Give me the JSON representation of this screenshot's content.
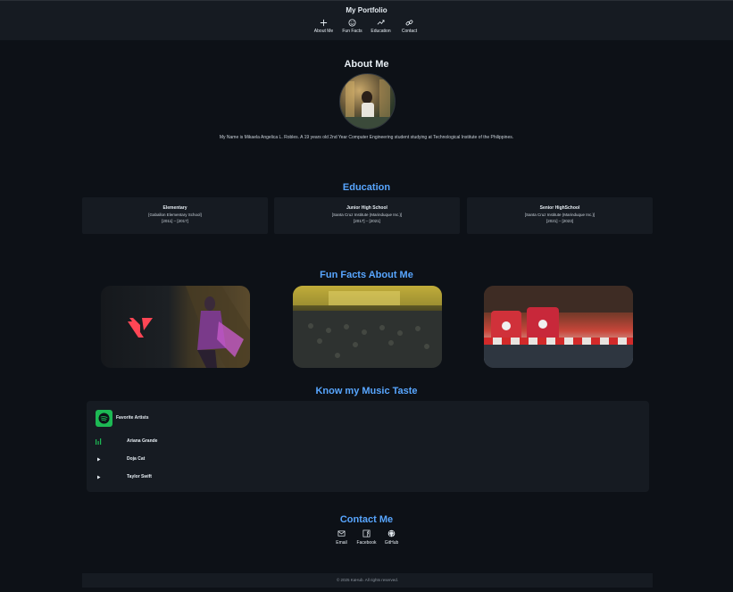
{
  "header": {
    "title": "My Portfolio",
    "nav": [
      {
        "label": "About Me",
        "icon": "plus-icon"
      },
      {
        "label": "Fun Facts",
        "icon": "smiley-icon"
      },
      {
        "label": "Education",
        "icon": "growth-icon"
      },
      {
        "label": "Contact",
        "icon": "chain-link-icon"
      }
    ]
  },
  "about": {
    "title": "About Me",
    "text": "My Name is Mikaela Angelica L. Robles. A 19 years old 2nd Year Computer Engineering student studying at Technological Institute of the Philippines."
  },
  "education": {
    "title": "Education",
    "items": [
      {
        "level": "Elementary",
        "school": "[Gaballon Elementary School]",
        "years": "[2011] – [2017]"
      },
      {
        "level": "Junior High School",
        "school": "[Santa Cruz Institute (Marinduque Inc.)]",
        "years": "[2017] – [2021]"
      },
      {
        "level": "Senior HighSchool",
        "school": "[Santa Cruz Institute (Marinduque Inc.)]",
        "years": "[2021] – [2023]"
      }
    ]
  },
  "fun_facts": {
    "title": "Fun Facts About Me"
  },
  "music": {
    "title": "Know my Music Taste",
    "heading": "Favorite Artists",
    "artists": [
      "Ariana Grande",
      "Doja Cat",
      "Taylor Swift"
    ],
    "accent": "#1db954"
  },
  "contact": {
    "title": "Contact Me",
    "links": [
      {
        "label": "Email",
        "icon": "envelope-icon"
      },
      {
        "label": "Facebook",
        "icon": "facebook-icon"
      },
      {
        "label": "GitHub",
        "icon": "github-icon"
      }
    ]
  },
  "footer": {
    "text": "© 2025 KaHub. All rights reserved."
  },
  "colors": {
    "background": "#0d1117",
    "card": "#161b22",
    "accent": "#58a6ff"
  }
}
